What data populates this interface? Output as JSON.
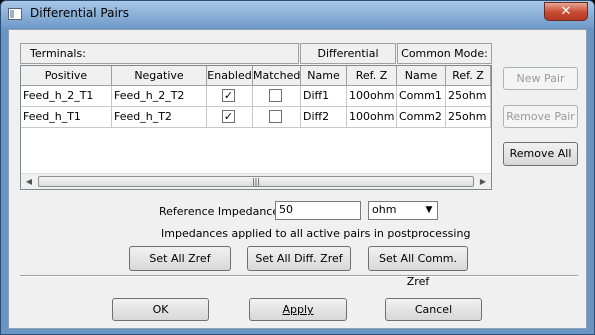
{
  "window": {
    "title": "Differential Pairs",
    "close_glyph": "✕"
  },
  "group_headers": {
    "terminals": "Terminals:",
    "differential_mode": "Differential Mode:",
    "common_mode": "Common Mode:"
  },
  "columns": [
    "Positive",
    "Negative",
    "Enabled",
    "Matched",
    "Name",
    "Ref. Z",
    "Name",
    "Ref. Z"
  ],
  "rows": [
    {
      "positive": "Feed_h_2_T1",
      "negative": "Feed_h_2_T2",
      "enabled": true,
      "matched": false,
      "diff_name": "Diff1",
      "diff_ref_z": "100ohm",
      "comm_name": "Comm1",
      "comm_ref_z": "25ohm"
    },
    {
      "positive": "Feed_h_T1",
      "negative": "Feed_h_T2",
      "enabled": true,
      "matched": false,
      "diff_name": "Diff2",
      "diff_ref_z": "100ohm",
      "comm_name": "Comm2",
      "comm_ref_z": "25ohm"
    }
  ],
  "scrollbar": {
    "left_arrow": "◀",
    "right_arrow": "▶",
    "grip": "|||"
  },
  "side_buttons": {
    "new_pair": "New Pair",
    "remove_pair": "Remove Pair",
    "remove_all": "Remove All"
  },
  "reference": {
    "label": "Reference Impedance:",
    "value": "50",
    "unit": "ohm",
    "note": "Impedances applied to all active pairs in postprocessing"
  },
  "zref_buttons": {
    "set_all": "Set All Zref",
    "set_all_diff": "Set All Diff. Zref",
    "set_all_comm": "Set All Comm. Zref"
  },
  "footer": {
    "ok": "OK",
    "apply": "Apply",
    "cancel": "Cancel"
  },
  "icons": {
    "checkmark": "✓",
    "dropdown": "▼"
  }
}
